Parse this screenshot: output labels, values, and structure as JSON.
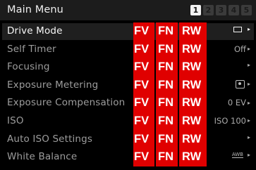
{
  "header": {
    "title": "Main Menu",
    "pages": [
      "1",
      "2",
      "3",
      "4",
      "5"
    ],
    "active_page": "1"
  },
  "overlay_tags": [
    "FV",
    "FN",
    "RW"
  ],
  "menu_items": [
    {
      "label": "Drive Mode",
      "value": "",
      "icon": "single-frame-icon",
      "selected": true
    },
    {
      "label": "Self Timer",
      "value": "Off",
      "icon": "",
      "selected": false
    },
    {
      "label": "Focusing",
      "value": "",
      "icon": "",
      "selected": false
    },
    {
      "label": "Exposure Metering",
      "value": "",
      "icon": "spot-metering-icon",
      "selected": false
    },
    {
      "label": "Exposure Compensation",
      "value": "0 EV",
      "icon": "",
      "selected": false
    },
    {
      "label": "ISO",
      "value": "ISO 100",
      "icon": "",
      "selected": false
    },
    {
      "label": "Auto ISO Settings",
      "value": "",
      "icon": "",
      "selected": false
    },
    {
      "label": "White Balance",
      "value": "AWB",
      "icon": "auto-white-balance-icon",
      "selected": false
    }
  ],
  "colors": {
    "tag_red": "#e00000",
    "header_bg": "#1c1c1c",
    "selected_row_bg": "#1f1f1f"
  }
}
